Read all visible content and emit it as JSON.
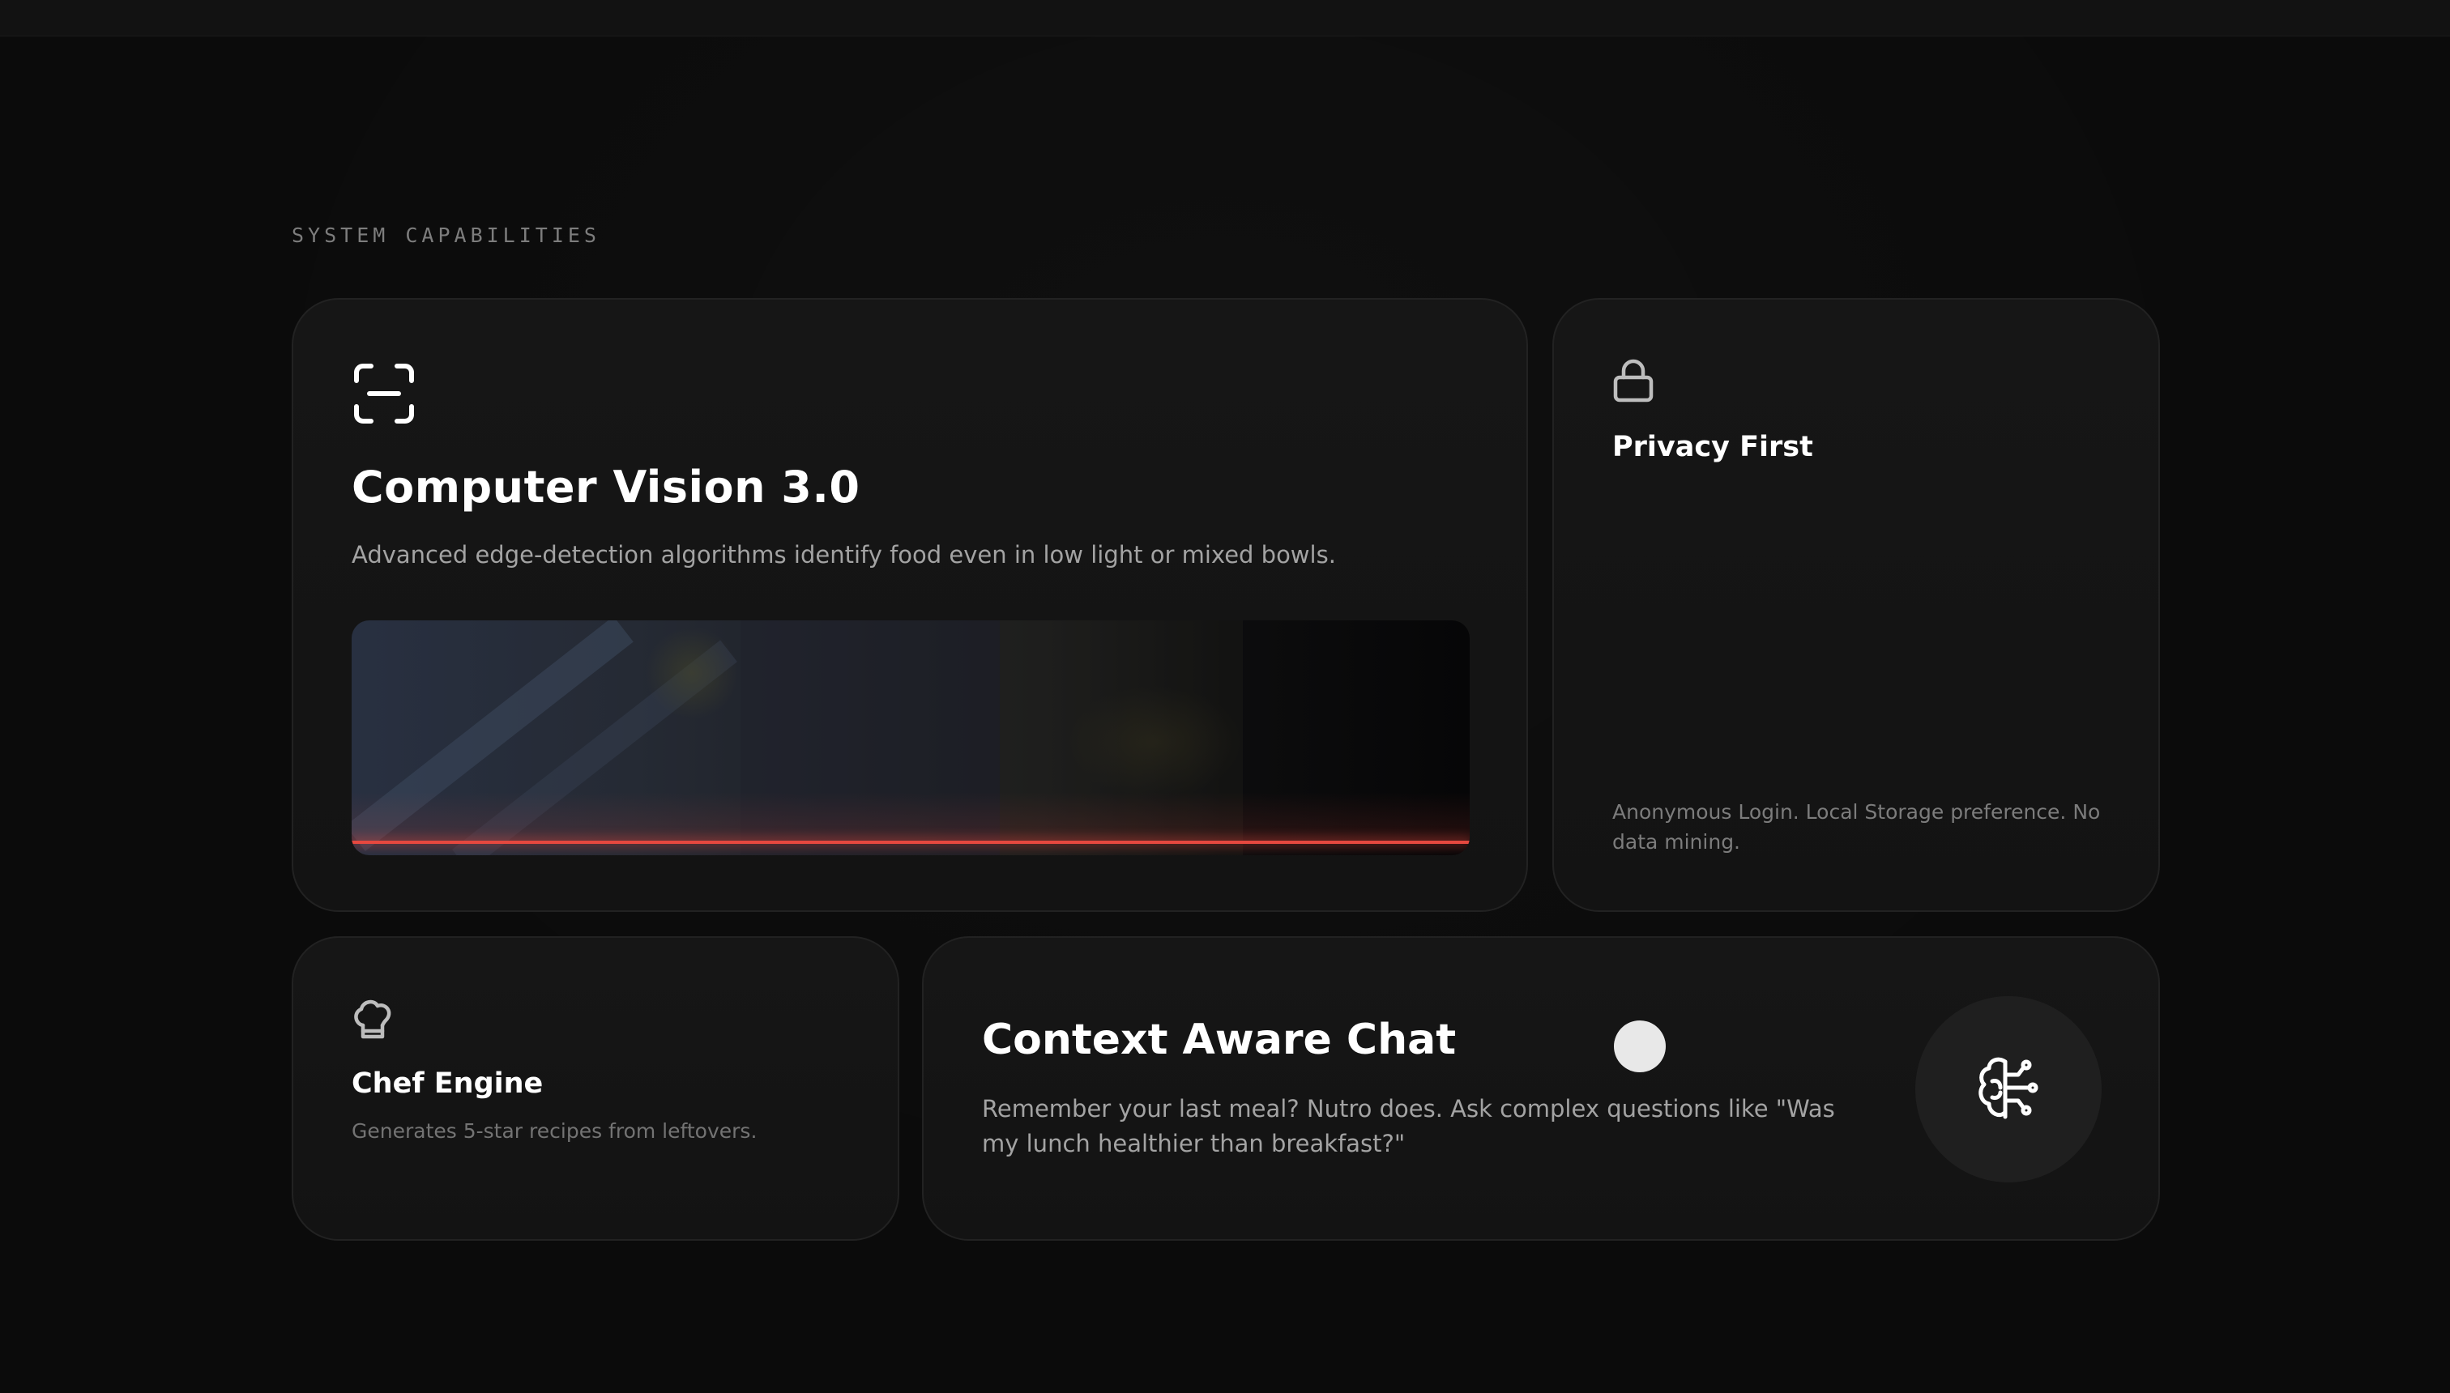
{
  "section": {
    "label": "SYSTEM CAPABILITIES"
  },
  "colors": {
    "background": "#0b0b0b",
    "card": "#151515",
    "scan_line": "#e5483f",
    "text_primary": "#ffffff",
    "text_secondary": "#a3a3a3"
  },
  "cards": {
    "computer_vision": {
      "icon": "scan-icon",
      "title": "Computer Vision 3.0",
      "description": "Advanced edge-detection algorithms identify food even in low light or mixed bowls."
    },
    "privacy": {
      "icon": "lock-icon",
      "title": "Privacy First",
      "description": "Anonymous Login. Local Storage preference. No data mining."
    },
    "chef": {
      "icon": "chef-hat-icon",
      "title": "Chef Engine",
      "description": "Generates 5-star recipes from leftovers."
    },
    "chat": {
      "icon": "brain-circuit-icon",
      "title": "Context Aware Chat",
      "description": "Remember your last meal? Nutro does. Ask complex questions like \"Was my lunch healthier than breakfast?\""
    }
  }
}
